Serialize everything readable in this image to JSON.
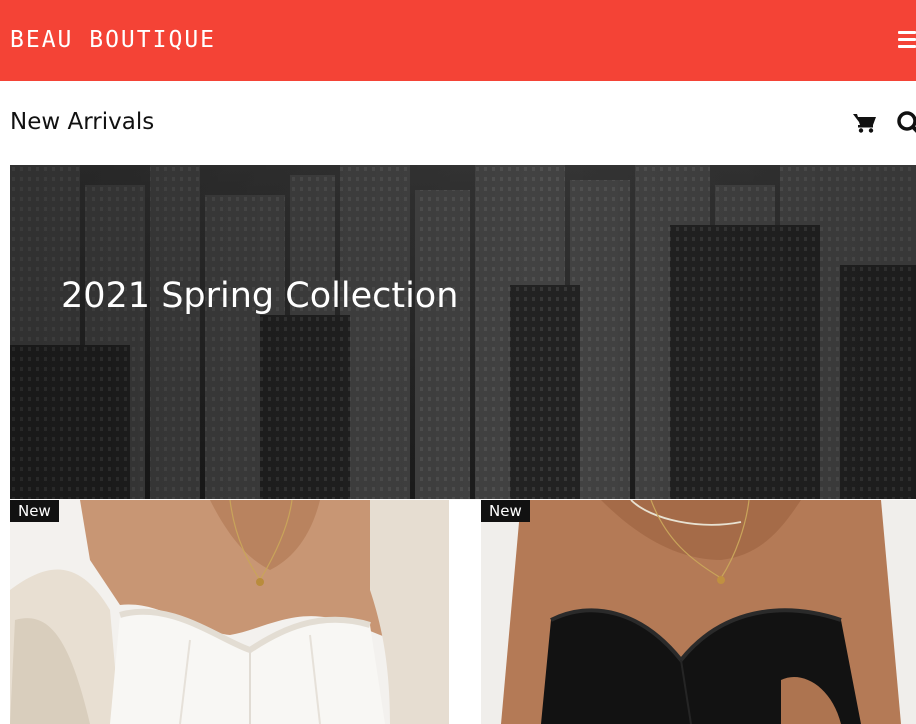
{
  "header": {
    "brand": "BEAU BOUTIQUE",
    "menu_icon": "hamburger-menu-icon",
    "background_color": "#f44336"
  },
  "subheader": {
    "title": "New Arrivals",
    "cart_icon": "shopping-cart-icon",
    "search_icon": "search-icon"
  },
  "hero": {
    "title": "2021 Spring Collection"
  },
  "products": [
    {
      "badge": "New"
    },
    {
      "badge": "New"
    }
  ]
}
